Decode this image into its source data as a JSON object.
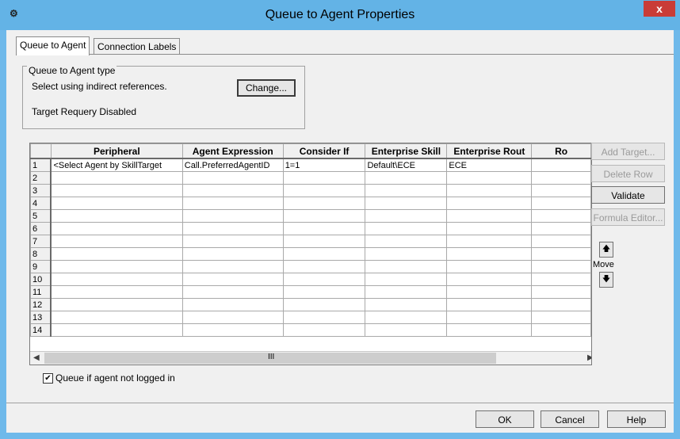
{
  "window": {
    "title": "Queue to Agent Properties",
    "close_label": "x",
    "icon": "app-icon"
  },
  "tabs": [
    {
      "label": "Queue to Agent",
      "active": true
    },
    {
      "label": "Connection Labels",
      "active": false
    }
  ],
  "type_group": {
    "legend": "Queue to Agent type",
    "line1": "Select using indirect references.",
    "line2": "Target Requery Disabled",
    "change_label": "Change..."
  },
  "grid": {
    "columns": [
      "Peripheral",
      "Agent Expression",
      "Consider If",
      "Enterprise Skill",
      "Enterprise Rout",
      "Ro"
    ],
    "rows": [
      {
        "n": "1",
        "cells": [
          "<Select Agent by SkillTarget",
          "Call.PreferredAgentID",
          "1=1",
          "Default\\ECE",
          "ECE",
          ""
        ]
      },
      {
        "n": "2",
        "cells": [
          "",
          "",
          "",
          "",
          "",
          ""
        ]
      },
      {
        "n": "3",
        "cells": [
          "",
          "",
          "",
          "",
          "",
          ""
        ]
      },
      {
        "n": "4",
        "cells": [
          "",
          "",
          "",
          "",
          "",
          ""
        ]
      },
      {
        "n": "5",
        "cells": [
          "",
          "",
          "",
          "",
          "",
          ""
        ]
      },
      {
        "n": "6",
        "cells": [
          "",
          "",
          "",
          "",
          "",
          ""
        ]
      },
      {
        "n": "7",
        "cells": [
          "",
          "",
          "",
          "",
          "",
          ""
        ]
      },
      {
        "n": "8",
        "cells": [
          "",
          "",
          "",
          "",
          "",
          ""
        ]
      },
      {
        "n": "9",
        "cells": [
          "",
          "",
          "",
          "",
          "",
          ""
        ]
      },
      {
        "n": "10",
        "cells": [
          "",
          "",
          "",
          "",
          "",
          ""
        ]
      },
      {
        "n": "11",
        "cells": [
          "",
          "",
          "",
          "",
          "",
          ""
        ]
      },
      {
        "n": "12",
        "cells": [
          "",
          "",
          "",
          "",
          "",
          ""
        ]
      },
      {
        "n": "13",
        "cells": [
          "",
          "",
          "",
          "",
          "",
          ""
        ]
      },
      {
        "n": "14",
        "cells": [
          "",
          "",
          "",
          "",
          "",
          ""
        ]
      }
    ],
    "scroll_thumb_label": "III"
  },
  "side_buttons": {
    "add_target": "Add Target...",
    "delete_row": "Delete Row",
    "validate": "Validate",
    "formula_editor": "Formula Editor...",
    "move_label": "Move"
  },
  "checkbox": {
    "label": "Queue if agent not logged in",
    "checked": true
  },
  "footer": {
    "ok": "OK",
    "cancel": "Cancel",
    "help": "Help"
  }
}
